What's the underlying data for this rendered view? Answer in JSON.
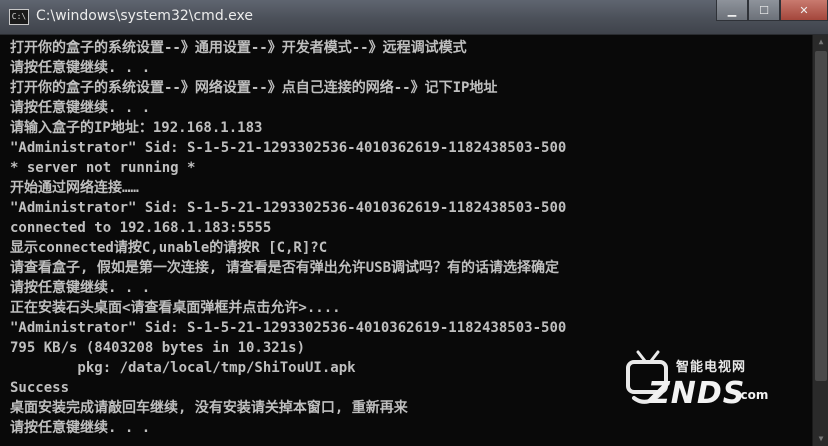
{
  "window": {
    "title": "C:\\windows\\system32\\cmd.exe",
    "icon_text": "C:\\",
    "buttons": {
      "minimize": "▁",
      "maximize": "☐",
      "close": "✕"
    }
  },
  "console": {
    "lines": [
      "打开你的盒子的系统设置--》通用设置--》开发者模式--》远程调试模式",
      "请按任意键继续. . .",
      "打开你的盒子的系统设置--》网络设置--》点自己连接的网络--》记下IP地址",
      "请按任意键继续. . .",
      "请输入盒子的IP地址：192.168.1.183",
      "\"Administrator\" Sid: S-1-5-21-1293302536-4010362619-1182438503-500",
      "* server not running *",
      "开始通过网络连接……",
      "\"Administrator\" Sid: S-1-5-21-1293302536-4010362619-1182438503-500",
      "connected to 192.168.1.183:5555",
      "显示connected请按C,unable的请按R [C,R]?C",
      "请查看盒子, 假如是第一次连接, 请查看是否有弹出允许USB调试吗？有的话请选择确定",
      "请按任意键继续. . .",
      "正在安装石头桌面<请查看桌面弹框并点击允许>....",
      "\"Administrator\" Sid: S-1-5-21-1293302536-4010362619-1182438503-500",
      "795 KB/s (8403208 bytes in 10.321s)",
      "        pkg: /data/local/tmp/ShiTouUI.apk",
      "Success",
      "桌面安装完成请敲回车继续, 没有安装请关掉本窗口, 重新再来",
      "请按任意键继续. . ."
    ]
  },
  "watermark": {
    "cn": "智能电视网",
    "brand": "ZNDS",
    "domain": ".com"
  },
  "icons": {
    "app": "cmd-app-icon",
    "tv": "tv-icon"
  }
}
